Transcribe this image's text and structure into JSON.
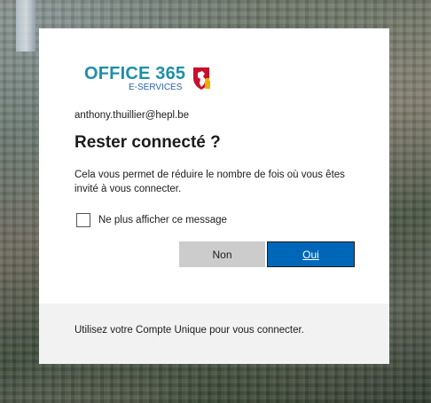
{
  "logo": {
    "main_text": "OFFICE 365",
    "sub_text": "E-SERVICES",
    "colors": {
      "main": "#1f8fa6",
      "sub": "#2a62a8",
      "shield": "#c8102e"
    }
  },
  "account": {
    "email": "anthony.thuillier@hepl.be"
  },
  "dialog": {
    "title": "Rester connecté ?",
    "description": "Cela vous permet de réduire le nombre de fois où vous êtes invité à vous connecter.",
    "checkbox_label": "Ne plus afficher ce message",
    "checkbox_checked": false
  },
  "buttons": {
    "no_label": "Non",
    "yes_label": "Oui"
  },
  "footer": {
    "text": "Utilisez votre Compte Unique pour vous connecter."
  },
  "colors": {
    "primary": "#0067b8",
    "secondary_button": "#cccccc",
    "footer_bg": "#f2f2f2"
  }
}
